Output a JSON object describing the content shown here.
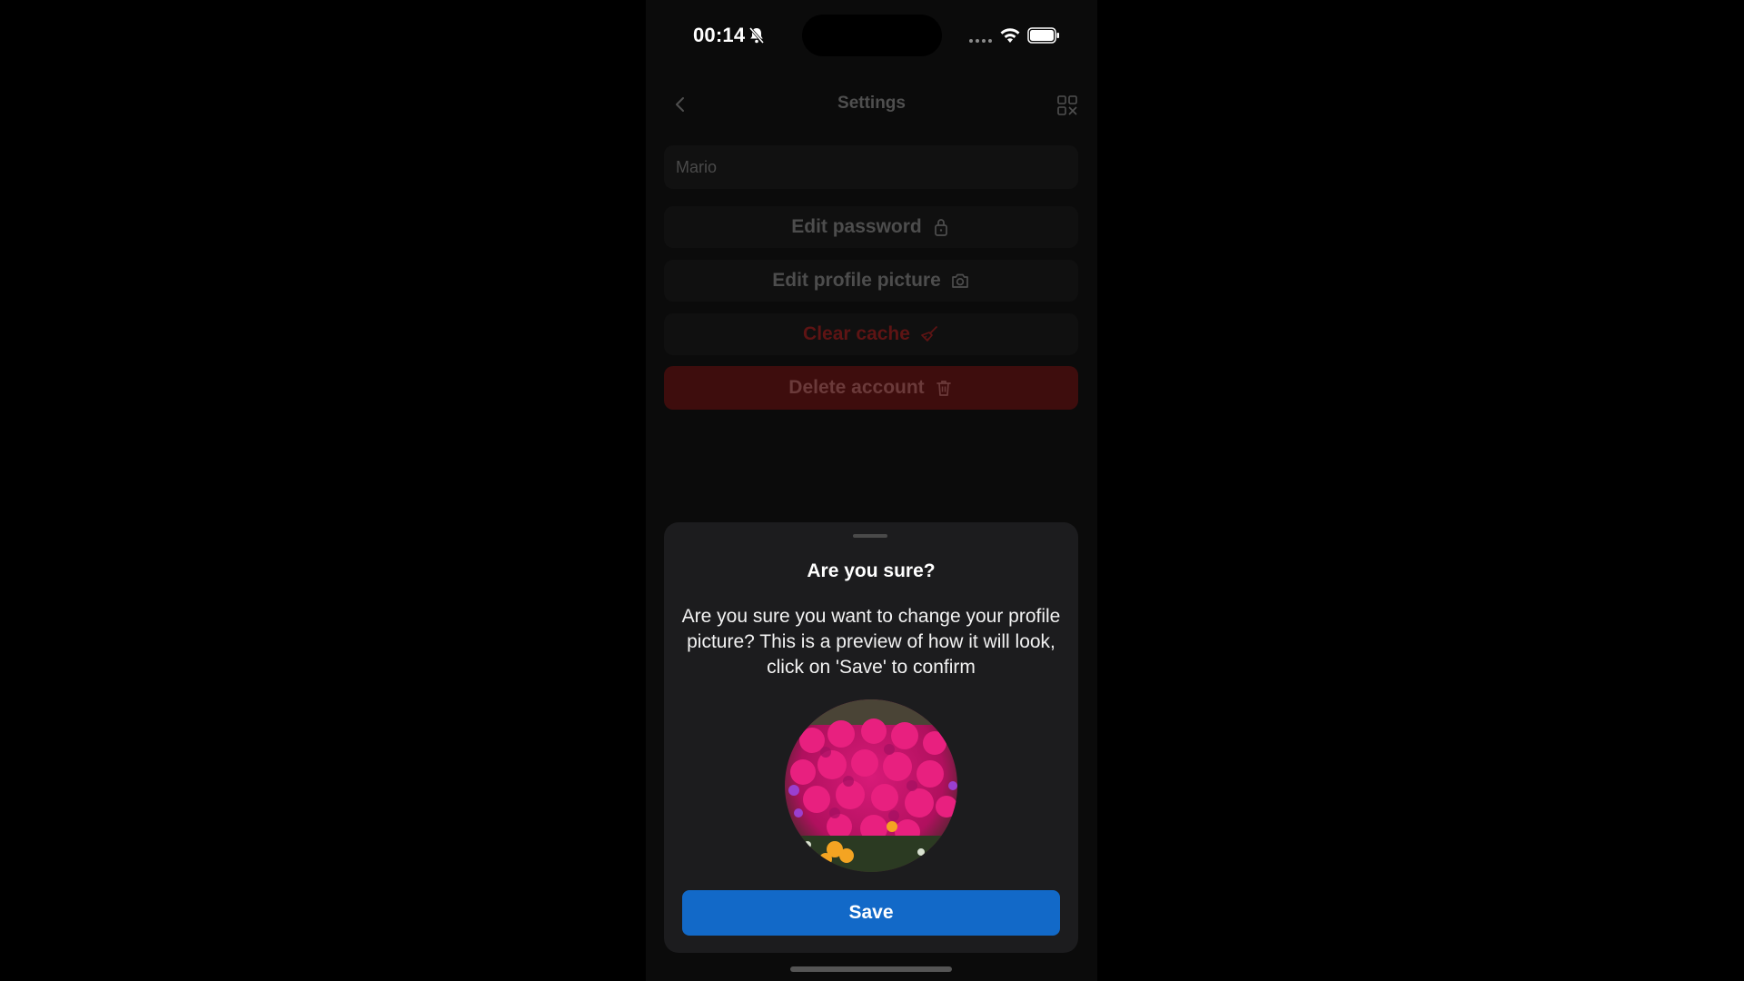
{
  "status_bar": {
    "time": "00:14"
  },
  "header": {
    "title": "Settings"
  },
  "settings": {
    "name_value": "Mario",
    "edit_password": "Edit password",
    "edit_profile_picture": "Edit profile picture",
    "clear_cache": "Clear cache",
    "delete_account": "Delete account"
  },
  "sheet": {
    "title": "Are you sure?",
    "message": "Are you sure you want to change your profile picture? This is a preview of how it will look, click on 'Save' to confirm",
    "save_label": "Save"
  },
  "icons": {
    "bell": "bell-slash-icon",
    "wifi": "wifi-icon",
    "battery": "battery-icon",
    "back": "chevron-left-icon",
    "qr": "qr-code-icon",
    "lock": "lock-icon",
    "camera": "camera-icon",
    "broom": "broom-icon",
    "trash": "trash-icon"
  },
  "colors": {
    "save_button": "#1269c8",
    "delete_button": "#3e0d0d",
    "clear_cache_text": "#5e1414",
    "sheet_background": "#1c1c1e"
  }
}
